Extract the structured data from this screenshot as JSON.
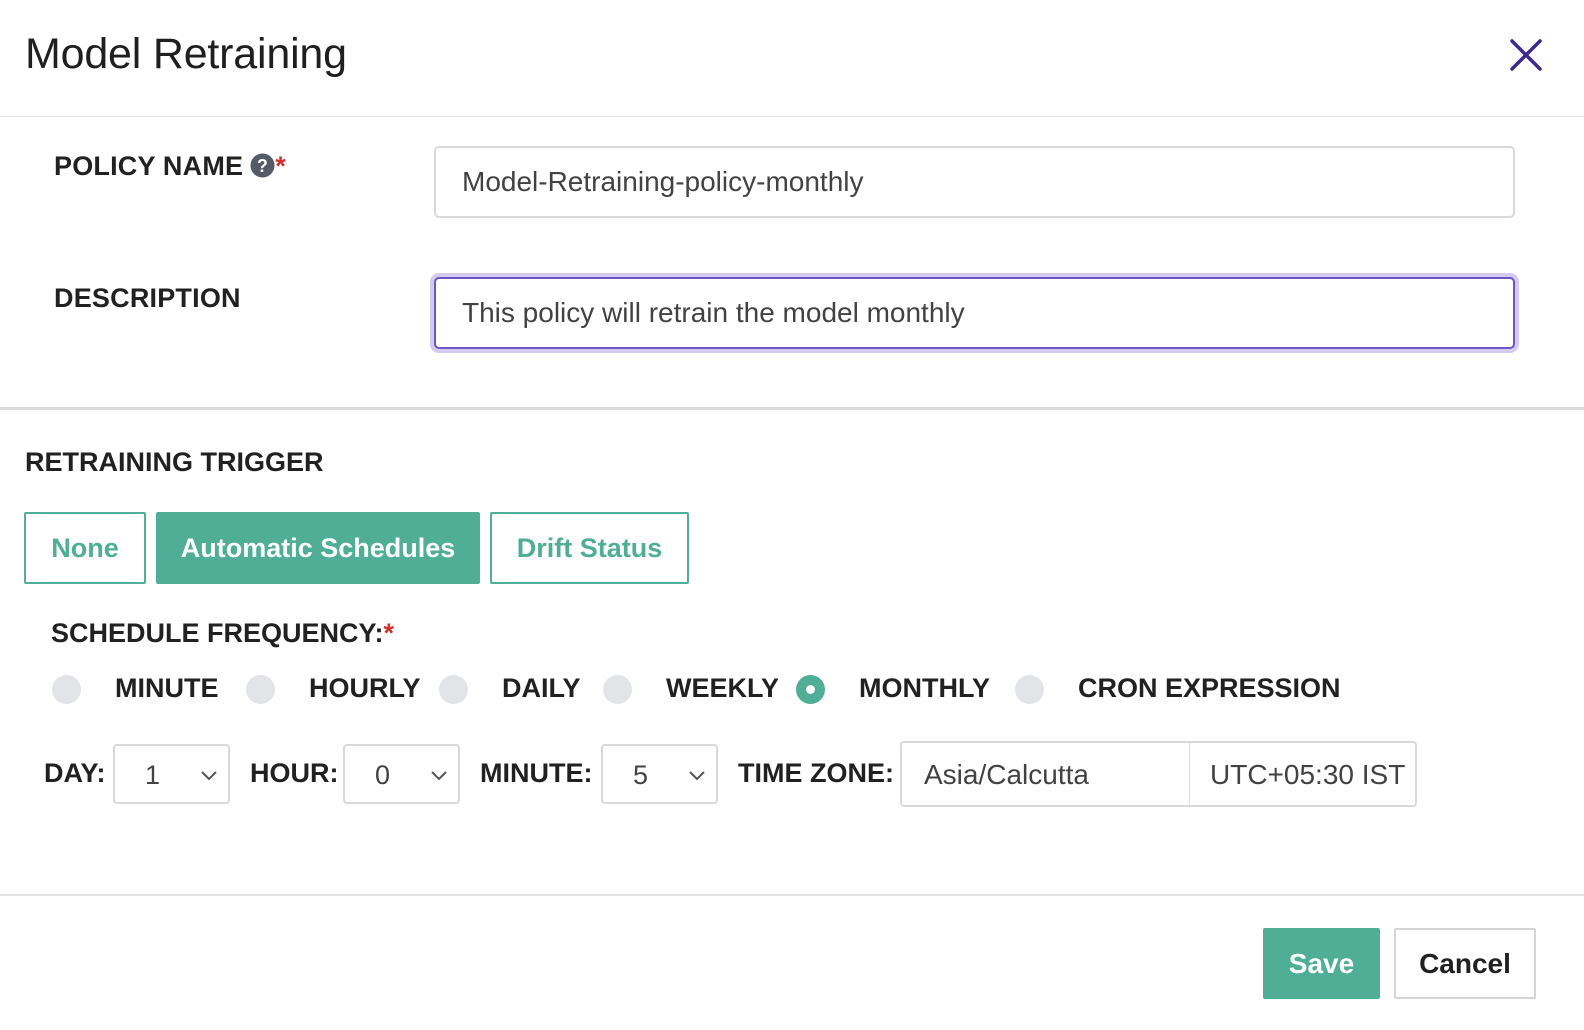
{
  "dialog": {
    "title": "Model Retraining",
    "close_icon": "close-icon"
  },
  "form": {
    "policy_name": {
      "label": "POLICY NAME",
      "required_mark": "*",
      "help_icon": "question-circle-icon",
      "value": "Model-Retraining-policy-monthly"
    },
    "description": {
      "label": "DESCRIPTION",
      "value": "This policy will retrain the model monthly"
    }
  },
  "trigger": {
    "title": "RETRAINING TRIGGER",
    "options": [
      "None",
      "Automatic Schedules",
      "Drift Status"
    ],
    "selected": "Automatic Schedules"
  },
  "schedule": {
    "label": "SCHEDULE FREQUENCY:",
    "required_mark": "*",
    "frequencies": [
      "MINUTE",
      "HOURLY",
      "DAILY",
      "WEEKLY",
      "MONTHLY",
      "CRON EXPRESSION"
    ],
    "selected": "MONTHLY",
    "day": {
      "label": "DAY:",
      "value": "1"
    },
    "hour": {
      "label": "HOUR:",
      "value": "0"
    },
    "minute": {
      "label": "MINUTE:",
      "value": "5"
    },
    "timezone": {
      "label": "TIME ZONE:",
      "name": "Asia/Calcutta",
      "offset": "UTC+05:30 IST"
    }
  },
  "footer": {
    "save_label": "Save",
    "cancel_label": "Cancel"
  },
  "colors": {
    "accent": "#4fae95",
    "focus": "#6c55c4",
    "close": "#3b2a8c",
    "required": "#d32f2f"
  }
}
